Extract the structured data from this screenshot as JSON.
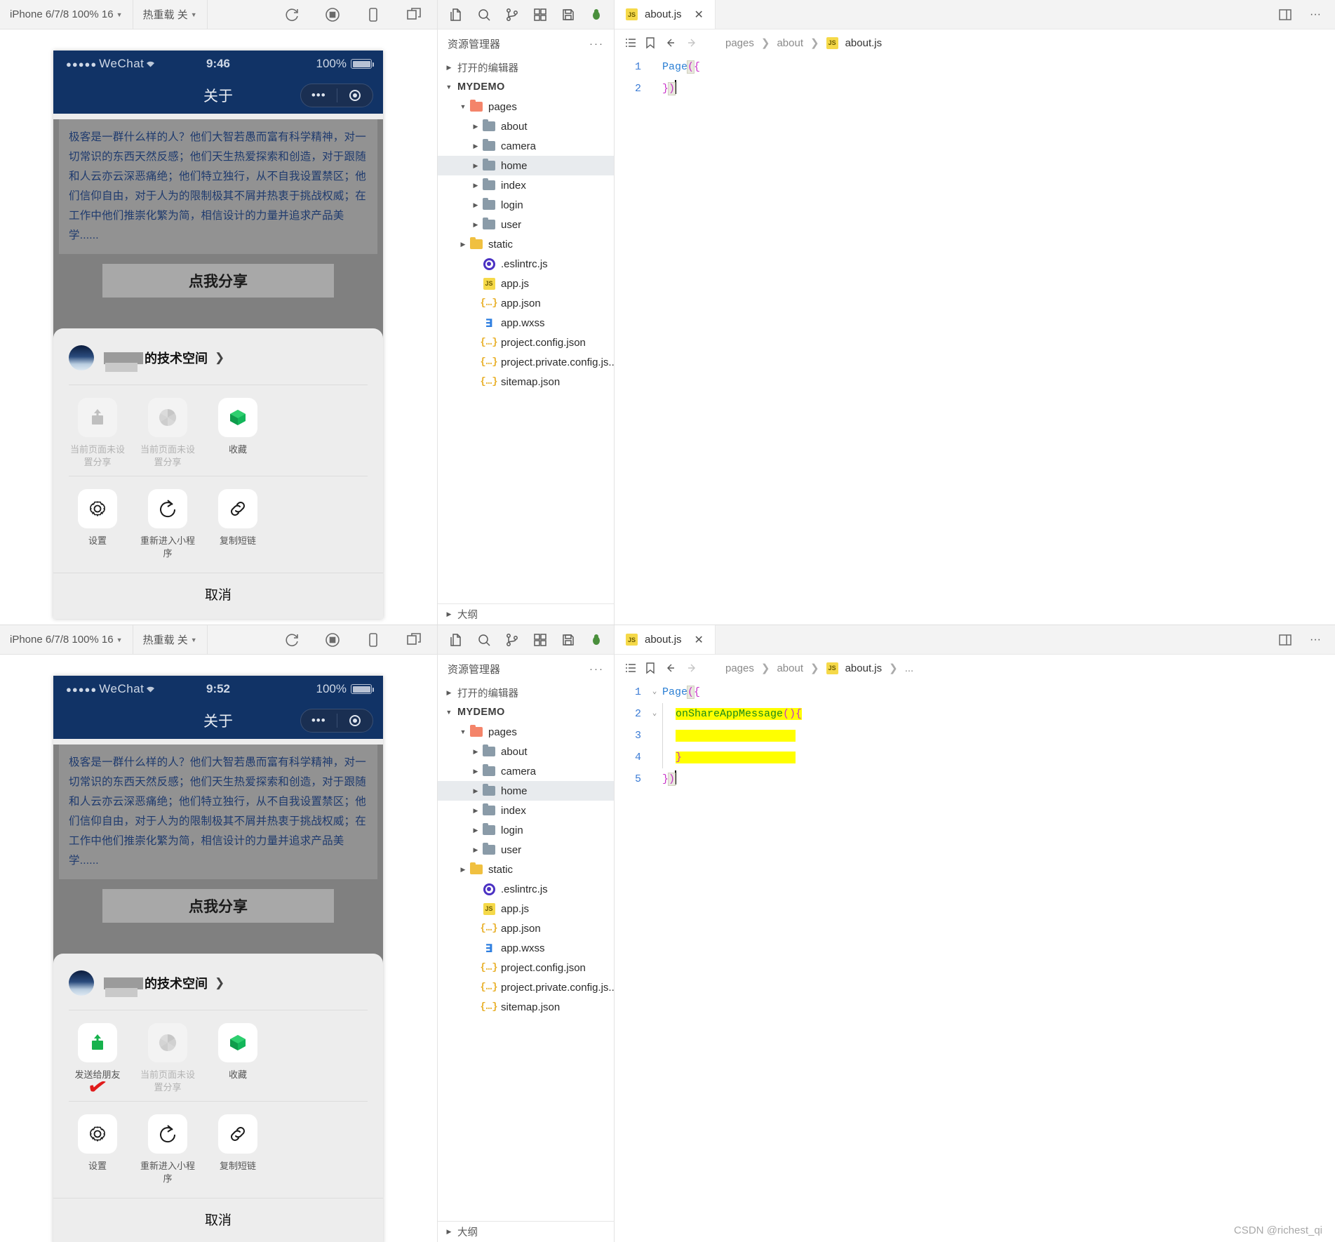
{
  "simulator_toolbar": {
    "device_label": "iPhone 6/7/8 100% 16",
    "hotreload_label": "热重载 关",
    "icons": [
      "refresh-icon",
      "record-icon",
      "device-icon",
      "split-icon"
    ]
  },
  "phone": {
    "top": {
      "carrier": "WeChat",
      "time": "9:46",
      "battery": "100%",
      "nav_title": "关于"
    },
    "bottom": {
      "carrier": "WeChat",
      "time": "9:52",
      "battery": "100%",
      "nav_title": "关于"
    },
    "article_text": "极客是一群什么样的人？他们大智若愚而富有科学精神，对一切常识的东西天然反感；他们天生热爱探索和创造，对于跟随和人云亦云深恶痛绝；他们特立独行，从不自我设置禁区；他们信仰自由，对于人为的限制极其不屑并热衷于挑战权威；在工作中他们推崇化繁为简，相信设计的力量并追求产品美学......",
    "share_button": "点我分享",
    "user_name_suffix": "的技术空间",
    "cancel_label": "取消",
    "share_row_top": [
      {
        "icon": "share-upload-icon",
        "label": "当前页面未设置分享",
        "state": "disabled"
      },
      {
        "icon": "aperture-icon",
        "label": "当前页面未设置分享",
        "state": "disabled"
      },
      {
        "icon": "cube-icon",
        "label": "收藏",
        "state": "active"
      }
    ],
    "share_row_bottom": [
      {
        "icon": "share-upload-icon",
        "label": "发送给朋友",
        "state": "enabled",
        "mark": "✔"
      },
      {
        "icon": "aperture-icon",
        "label": "当前页面未设置分享",
        "state": "disabled"
      },
      {
        "icon": "cube-icon",
        "label": "收藏",
        "state": "active"
      }
    ],
    "tool_row": [
      {
        "icon": "gear-icon",
        "label": "设置"
      },
      {
        "icon": "reload-icon",
        "label": "重新进入小程序"
      },
      {
        "icon": "link-icon",
        "label": "复制短链"
      }
    ]
  },
  "explorer": {
    "title": "资源管理器",
    "more_label": "···",
    "open_editors": "打开的编辑器",
    "project": "MYDEMO",
    "outline": "大纲",
    "action_icons": [
      "new-file-icon",
      "search-icon",
      "source-control-icon",
      "extensions-icon",
      "save-icon",
      "debug-icon"
    ],
    "tree": [
      {
        "name": "pages",
        "type": "folder-pages",
        "depth": 1,
        "expanded": true
      },
      {
        "name": "about",
        "type": "folder",
        "depth": 2,
        "expanded": false
      },
      {
        "name": "camera",
        "type": "folder",
        "depth": 2,
        "expanded": false
      },
      {
        "name": "home",
        "type": "folder",
        "depth": 2,
        "expanded": false,
        "selected": true
      },
      {
        "name": "index",
        "type": "folder",
        "depth": 2,
        "expanded": false
      },
      {
        "name": "login",
        "type": "folder",
        "depth": 2,
        "expanded": false
      },
      {
        "name": "user",
        "type": "folder",
        "depth": 2,
        "expanded": false
      },
      {
        "name": "static",
        "type": "folder-static",
        "depth": 1,
        "expanded": false
      },
      {
        "name": ".eslintrc.js",
        "type": "eslint",
        "depth": 2
      },
      {
        "name": "app.js",
        "type": "js",
        "depth": 2
      },
      {
        "name": "app.json",
        "type": "json",
        "depth": 2
      },
      {
        "name": "app.wxss",
        "type": "css",
        "depth": 2
      },
      {
        "name": "project.config.json",
        "type": "json",
        "depth": 2
      },
      {
        "name": "project.private.config.js...",
        "type": "json",
        "depth": 2
      },
      {
        "name": "sitemap.json",
        "type": "json",
        "depth": 2
      }
    ]
  },
  "editor_top": {
    "tab_label": "about.js",
    "tab_close": "✕",
    "breadcrumb": [
      "pages",
      "about",
      "about.js"
    ],
    "lines": [
      {
        "no": "1",
        "fold": "",
        "code": "Page({"
      },
      {
        "no": "2",
        "fold": "",
        "code": "})"
      }
    ]
  },
  "editor_bottom": {
    "tab_label": "about.js",
    "tab_close": "✕",
    "breadcrumb": [
      "pages",
      "about",
      "about.js",
      "..."
    ],
    "lines": [
      {
        "no": "1",
        "fold": "⌄",
        "code": "Page({"
      },
      {
        "no": "2",
        "fold": "⌄",
        "code": "  onShareAppMessage(){"
      },
      {
        "no": "3",
        "fold": "",
        "code": ""
      },
      {
        "no": "4",
        "fold": "",
        "code": "  }"
      },
      {
        "no": "5",
        "fold": "",
        "code": "})"
      }
    ]
  },
  "watermark": "CSDN @richest_qi",
  "colors": {
    "navbar_blue": "#113366",
    "highlight_yellow": "#ffff00",
    "accent_green": "#1aad19",
    "check_red": "#e01b1b"
  }
}
